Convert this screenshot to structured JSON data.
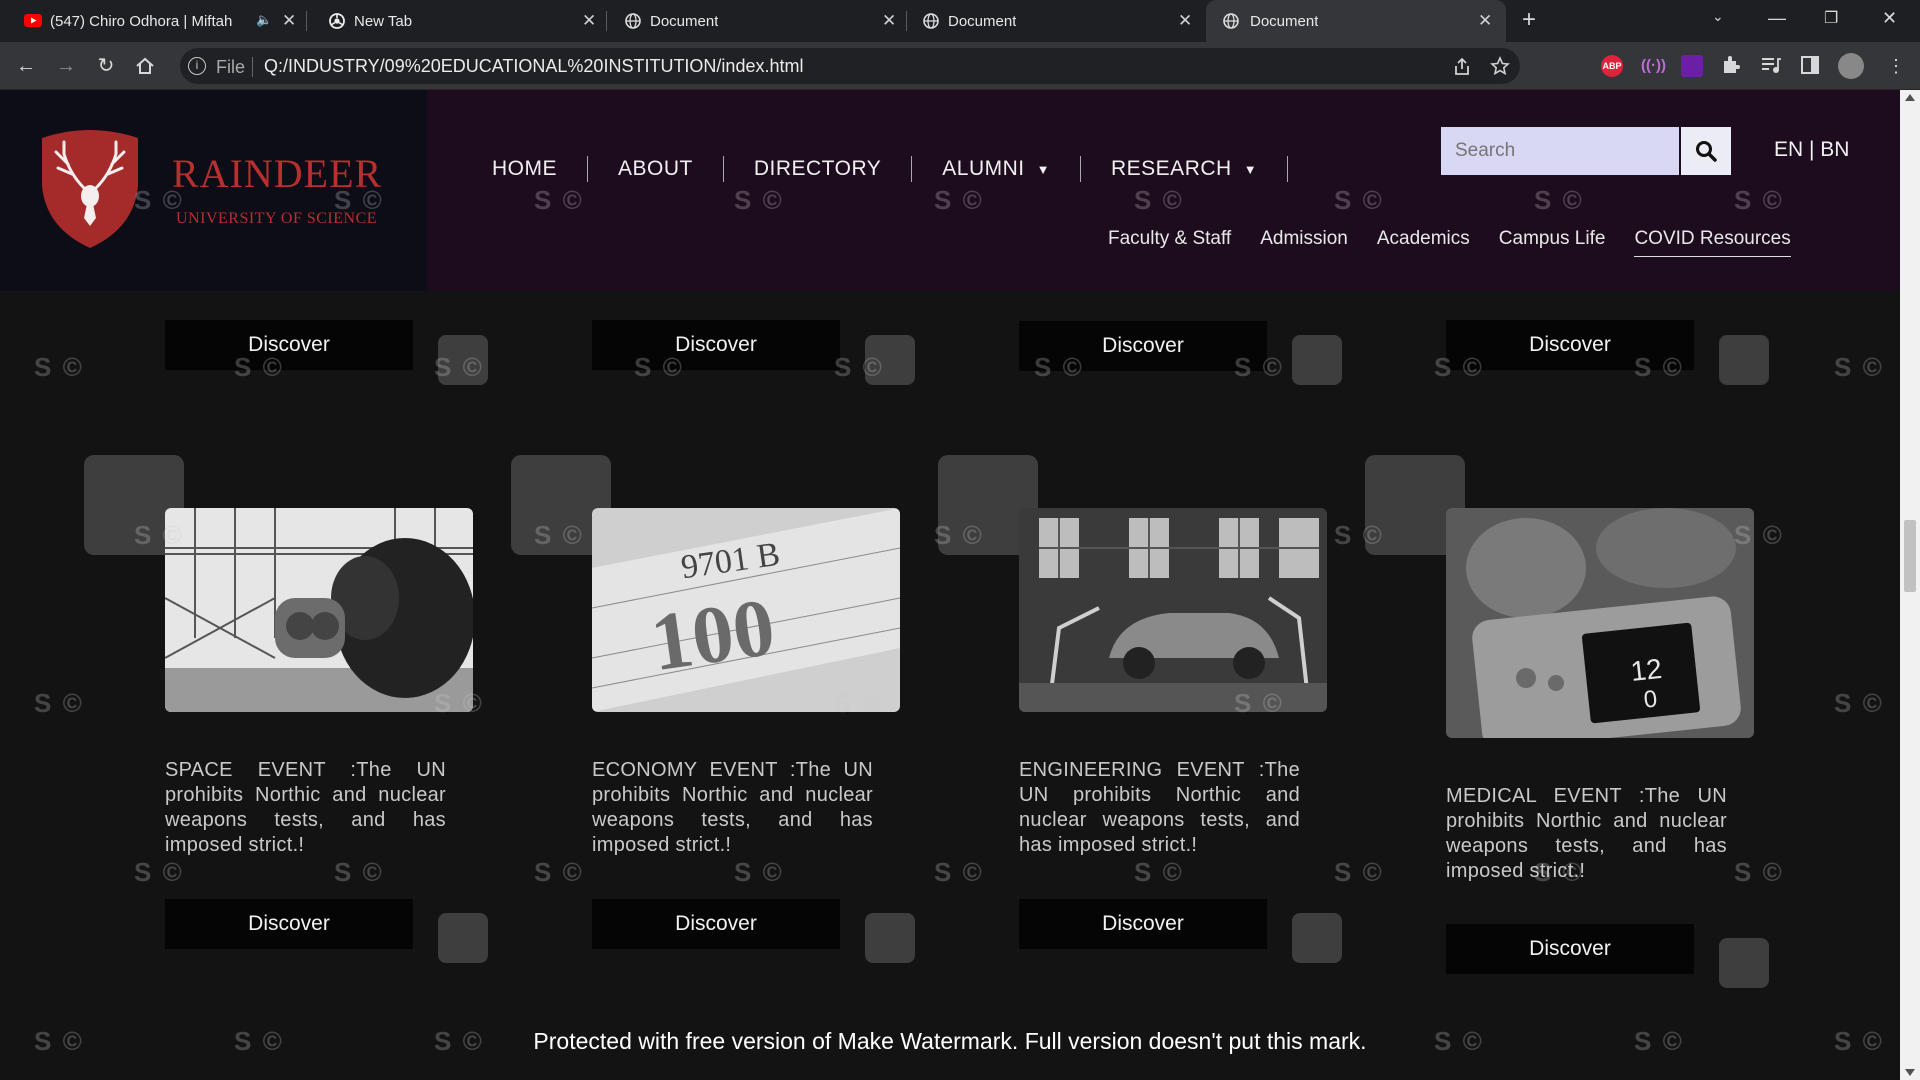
{
  "browser": {
    "tabs": [
      {
        "title": "(547) Chiro Odhora | Miftah",
        "favicon": "youtube-icon",
        "audio": true
      },
      {
        "title": "New Tab",
        "favicon": "chrome-icon"
      },
      {
        "title": "Document",
        "favicon": "globe-icon"
      },
      {
        "title": "Document",
        "favicon": "globe-icon"
      },
      {
        "title": "Document",
        "favicon": "globe-icon",
        "active": true
      }
    ],
    "address": {
      "scheme_label": "File",
      "url": "Q:/INDUSTRY/09%20EDUCATIONAL%20INSTITUTION/index.html"
    },
    "extensions": [
      "ABP"
    ]
  },
  "site": {
    "brand": {
      "name": "RAINDEER",
      "subtitle": "UNIVERSITY OF SCIENCE",
      "color": "#b82f2f"
    },
    "nav": [
      {
        "label": "HOME"
      },
      {
        "label": "ABOUT"
      },
      {
        "label": "DIRECTORY"
      },
      {
        "label": "ALUMNI",
        "dropdown": true
      },
      {
        "label": "RESEARCH",
        "dropdown": true
      }
    ],
    "search": {
      "placeholder": "Search"
    },
    "lang": "EN | BN",
    "subnav": [
      {
        "label": "Faculty & Staff"
      },
      {
        "label": "Admission"
      },
      {
        "label": "Academics"
      },
      {
        "label": "Campus Life"
      },
      {
        "label": "COVID Resources",
        "active": true
      }
    ]
  },
  "top_row": {
    "buttons": [
      "Discover",
      "Discover",
      "Discover",
      "Discover"
    ]
  },
  "events": [
    {
      "desc": "SPACE EVENT :The UN prohibits Northic and nuclear weapons tests, and has imposed strict.!",
      "button": "Discover",
      "image": "person-with-binoculars"
    },
    {
      "desc": "ECONOMY EVENT :The UN prohibits Northic and nuclear weapons tests, and has imposed strict.!",
      "button": "Discover",
      "image": "hundred-dollar-bill"
    },
    {
      "desc": "ENGINEERING EVENT :The UN prohibits Northic and nuclear weapons tests, and has imposed strict.!",
      "button": "Discover",
      "image": "car-assembly-line"
    },
    {
      "desc": "MEDICAL EVENT :The UN prohibits Northic and nuclear weapons tests, and has imposed strict.!",
      "button": "Discover",
      "image": "surgery-monitor"
    }
  ],
  "watermark": {
    "mark": "S ©",
    "banner": "Protected with free version of Make Watermark. Full version doesn't put this mark."
  }
}
